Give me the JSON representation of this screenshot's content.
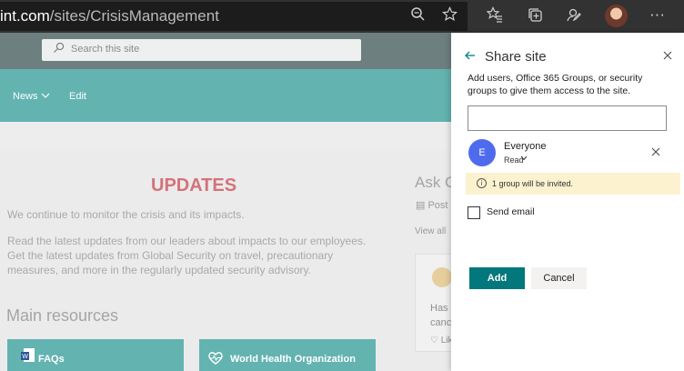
{
  "browser": {
    "url_host": "int.com",
    "url_path": "/sites/CrisisManagement",
    "icons": [
      "zoom-icon",
      "favorite-star-icon",
      "favorites-list-icon",
      "collections-icon",
      "feedback-icon",
      "avatar",
      "more-icon"
    ],
    "more_glyph": "···"
  },
  "site": {
    "search_placeholder": "Search this site",
    "nav": {
      "news": "News",
      "edit": "Edit"
    },
    "updates_heading": "UPDATES",
    "para1": "We continue to monitor the crisis and its impacts.",
    "para2_line1": "Read the latest updates from our leaders about impacts to our employees.",
    "para2_line2": "Get the latest updates from Global Security on travel, precautionary",
    "para2_line3": "measures, and more in the regularly updated security advisory.",
    "main_resources": "Main resources",
    "tiles": [
      {
        "label": "FAQs",
        "icon": "word-doc-icon"
      },
      {
        "label": "World Health Organization",
        "icon": "heart-icon"
      }
    ],
    "ask": "Ask C",
    "post": "Post",
    "view_all": "View all",
    "card_line1": "Has",
    "card_line2": "canc",
    "card_like": "Lik"
  },
  "share_panel": {
    "title": "Share site",
    "description": "Add users, Office 365 Groups, or security groups to give them access to the site.",
    "recipient": {
      "initial": "E",
      "name": "Everyone",
      "permission": "Read",
      "avatar_color": "#4f6bed"
    },
    "banner": "1 group will be invited.",
    "send_email_label": "Send email",
    "send_email_checked": false,
    "add_label": "Add",
    "cancel_label": "Cancel",
    "accent": "#03787c",
    "banner_color": "#fcf2cf"
  }
}
